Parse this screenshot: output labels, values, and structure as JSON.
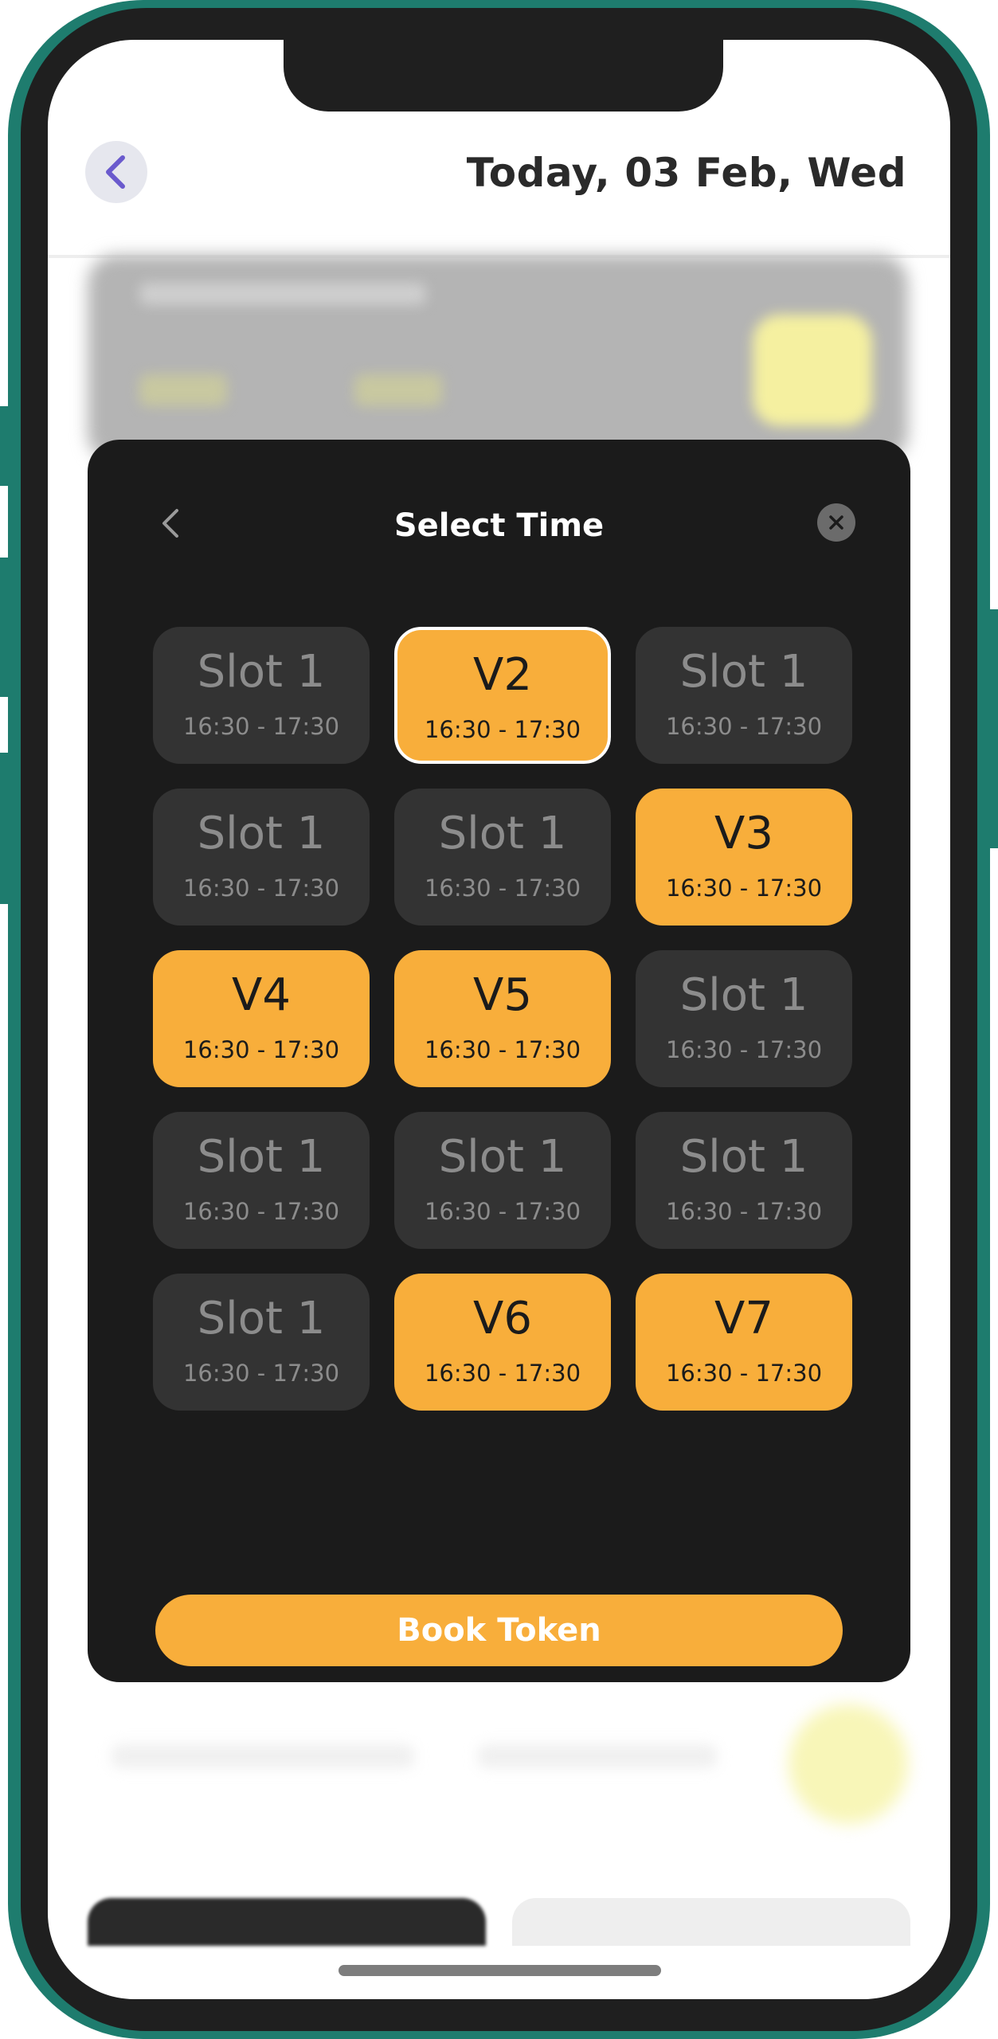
{
  "header": {
    "title": "Today, 03 Feb, Wed",
    "back_icon": "chevron-left-icon"
  },
  "modal": {
    "title": "Select Time",
    "back_icon": "chevron-left-icon",
    "close_icon": "close-icon",
    "book_label": "Book Token",
    "slots": [
      {
        "name": "Slot 1",
        "time": "16:30 - 17:30",
        "state": "empty"
      },
      {
        "name": "V2",
        "time": "16:30 - 17:30",
        "state": "selected"
      },
      {
        "name": "Slot 1",
        "time": "16:30 - 17:30",
        "state": "empty"
      },
      {
        "name": "Slot 1",
        "time": "16:30 - 17:30",
        "state": "empty"
      },
      {
        "name": "Slot 1",
        "time": "16:30 - 17:30",
        "state": "empty"
      },
      {
        "name": "V3",
        "time": "16:30 - 17:30",
        "state": "booked"
      },
      {
        "name": "V4",
        "time": "16:30 - 17:30",
        "state": "booked"
      },
      {
        "name": "V5",
        "time": "16:30 - 17:30",
        "state": "booked"
      },
      {
        "name": "Slot 1",
        "time": "16:30 - 17:30",
        "state": "empty"
      },
      {
        "name": "Slot 1",
        "time": "16:30 - 17:30",
        "state": "empty"
      },
      {
        "name": "Slot 1",
        "time": "16:30 - 17:30",
        "state": "empty"
      },
      {
        "name": "Slot 1",
        "time": "16:30 - 17:30",
        "state": "empty"
      },
      {
        "name": "Slot 1",
        "time": "16:30 - 17:30",
        "state": "empty"
      },
      {
        "name": "V6",
        "time": "16:30 - 17:30",
        "state": "booked"
      },
      {
        "name": "V7",
        "time": "16:30 - 17:30",
        "state": "booked"
      }
    ]
  },
  "colors": {
    "accent": "#f8ae3b",
    "modal_bg": "#1b1b1b",
    "slot_empty": "#333333",
    "frame": "#1e7c6e",
    "back_icon": "#6a5acd"
  }
}
